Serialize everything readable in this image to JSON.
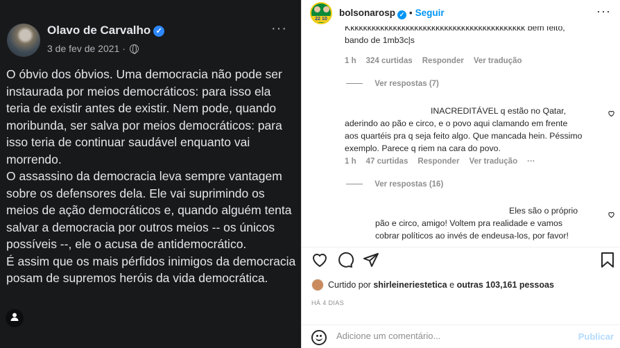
{
  "facebook_post": {
    "author": "Olavo de Carvalho",
    "date": "3 de fev de 2021 ·",
    "more": "···",
    "paragraphs": [
      "O óbvio dos óbvios. Uma democracia não pode ser instaurada por meios democráticos: para isso ela teria de existir antes de existir. Nem pode, quando moribunda, ser salva por meios democráticos: para isso teria de continuar saudável enquanto vai morrendo.",
      "O assassino da democracia leva sempre vantagem sobre os defensores dela. Ele vai suprimindo os meios de ação democráticos e, quando alguém tenta salvar a democracia por outros meios -- os únicos possíveis --, ele o acusa de antidemocrático.",
      "É assim que os mais pérfidos inimigos da democracia posam de supremos heróis da vida democrática."
    ]
  },
  "instagram": {
    "header": {
      "username": "bolsonarosp",
      "avatar_badge": "22 10",
      "separator": "•",
      "follow": "Seguir",
      "more": "···"
    },
    "comments": [
      {
        "text_line1": "Kkkkkkkkkkkkkkkkkkkkkkkkkkkkkkkkkkkkkkkkkk bem feito,",
        "text_line2": "bando de 1mb3c|s",
        "time": "1 h",
        "likes": "324 curtidas",
        "reply": "Responder",
        "translate": "Ver tradução",
        "view_replies": "Ver respostas (7)"
      },
      {
        "text_line1": "INACREDITÁVEL q estão no Qatar,",
        "text_rest": [
          "aderindo ao pão e circo, e o povo aqui clamando em frente",
          "aos quartéis pra q seja feito algo. Que mancada hein. Péssimo",
          "exemplo. Parece q riem na cara do povo."
        ],
        "time": "1 h",
        "likes": "47 curtidas",
        "reply": "Responder",
        "translate": "Ver tradução",
        "more": "···",
        "view_replies": "Ver respostas (16)"
      },
      {
        "text_line1": "Eles são o próprio",
        "text_rest": [
          "pão e circo, amigo! Voltem pra realidade e vamos",
          "cobrar políticos ao invés de endeusa-los, por favor!"
        ]
      }
    ],
    "liked_by": {
      "prefix": "Curtido por",
      "user": "shirleineriestetica",
      "connector": "e",
      "others": "outras 103,161 pessoas"
    },
    "time_ago": "HÁ 4 DIAS",
    "composer": {
      "placeholder": "Adicione um comentário...",
      "publish": "Publicar"
    }
  }
}
